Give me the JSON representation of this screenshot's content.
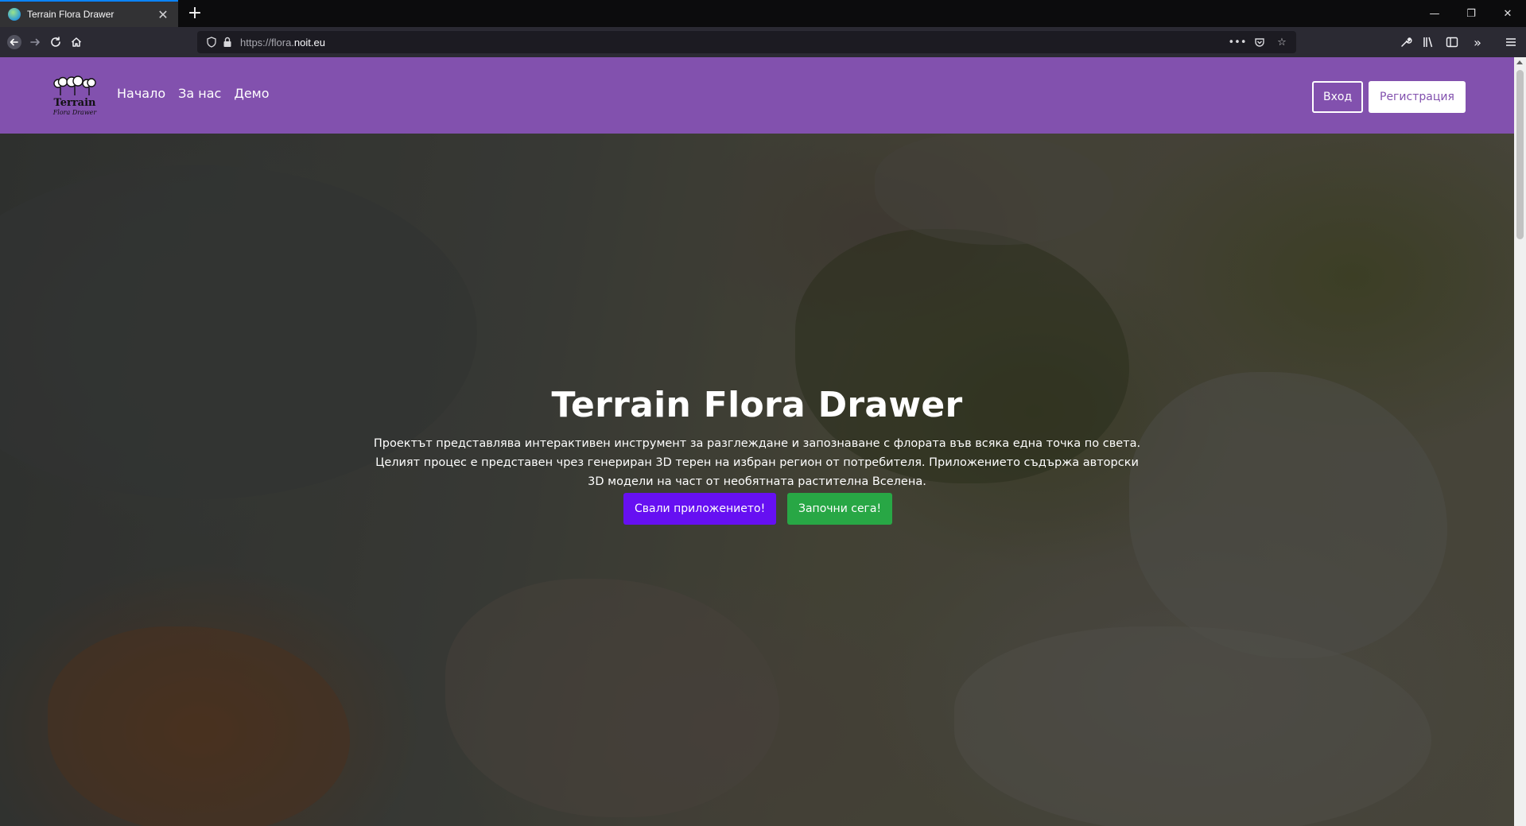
{
  "browser": {
    "tab_title": "Terrain Flora Drawer",
    "url_prefix": "https://flora.",
    "url_domain": "noit.eu",
    "icons": [
      "back-icon",
      "forward-icon",
      "reload-icon",
      "home-icon",
      "shield-icon",
      "lock-icon",
      "more-icon",
      "pocket-icon",
      "star-icon",
      "wrench-icon",
      "library-icon",
      "sidebar-icon",
      "overflow-icon",
      "menu-icon"
    ]
  },
  "site": {
    "logo_word": "Terrain",
    "logo_sub": "Flora Drawer",
    "nav": [
      "Начало",
      "За нас",
      "Демо"
    ],
    "login_label": "Вход",
    "register_label": "Регистрация",
    "accent_color": "#8251ae"
  },
  "hero": {
    "title": "Terrain Flora Drawer",
    "description_lines": [
      "Проектът представлява интерактивен инструмент за разглеждане и запознаване с флората във всяка една точка по света.",
      "Целият процес е представен чрез генериран 3D терен на избран регион от потребителя. Приложението съдържа авторски",
      "3D модели на част от необятната растителна Вселена."
    ],
    "download_label": "Свали приложението!",
    "start_label": "Започни сега!"
  }
}
